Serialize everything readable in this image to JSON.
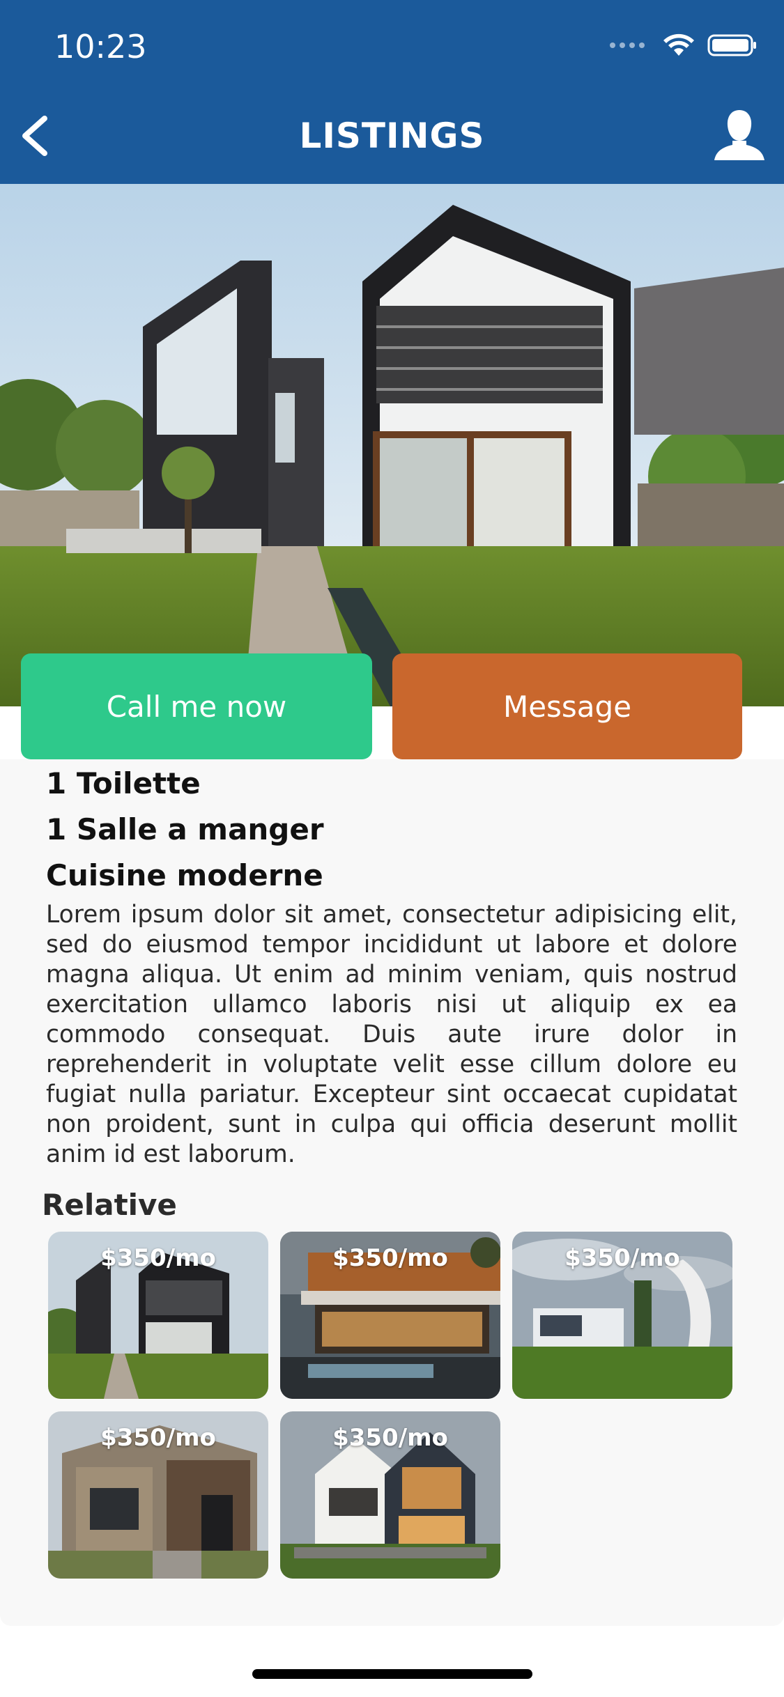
{
  "status": {
    "time": "10:23"
  },
  "header": {
    "title": "LISTINGS"
  },
  "actions": {
    "call_label": "Call me now",
    "message_label": "Message"
  },
  "features": [
    "1 Toilette",
    "1 Salle a manger",
    "Cuisine moderne"
  ],
  "description": "Lorem ipsum dolor sit amet, consectetur adipisicing elit, sed do eiusmod tempor incididunt ut labore et dolore magna aliqua. Ut enim ad minim veniam, quis nostrud exercitation ullamco laboris nisi ut aliquip ex ea commodo consequat. Duis aute irure dolor in reprehenderit in voluptate velit esse cillum dolore eu fugiat nulla pariatur. Excepteur sint occaecat cupidatat non proident, sunt in culpa qui officia deserunt mollit anim id est laborum.",
  "relative": {
    "title": "Relative",
    "listings": [
      {
        "price": "$350/mo"
      },
      {
        "price": "$350/mo"
      },
      {
        "price": "$350/mo"
      },
      {
        "price": "$350/mo"
      },
      {
        "price": "$350/mo"
      }
    ]
  },
  "colors": {
    "header": "#1b5a9b",
    "call": "#2ec98b",
    "message": "#c9672d",
    "content_bg": "#f8f8f8"
  }
}
